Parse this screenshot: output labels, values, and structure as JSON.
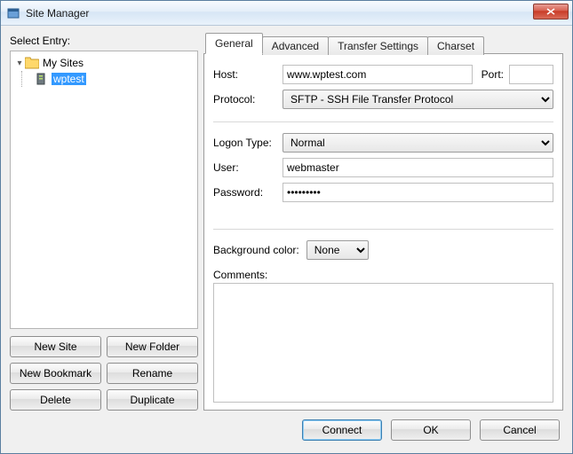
{
  "window": {
    "title": "Site Manager"
  },
  "left": {
    "label": "Select Entry:",
    "root": "My Sites",
    "site": "wptest",
    "buttons": {
      "new_site": "New Site",
      "new_folder": "New Folder",
      "new_bookmark": "New Bookmark",
      "rename": "Rename",
      "delete": "Delete",
      "duplicate": "Duplicate"
    }
  },
  "tabs": {
    "general": "General",
    "advanced": "Advanced",
    "transfer": "Transfer Settings",
    "charset": "Charset"
  },
  "form": {
    "host_label": "Host:",
    "host_value": "www.wptest.com",
    "port_label": "Port:",
    "port_value": "",
    "protocol_label": "Protocol:",
    "protocol_value": "SFTP - SSH File Transfer Protocol",
    "logon_label": "Logon Type:",
    "logon_value": "Normal",
    "user_label": "User:",
    "user_value": "webmaster",
    "password_label": "Password:",
    "password_value": "•••••••••",
    "bg_label": "Background color:",
    "bg_value": "None",
    "comments_label": "Comments:",
    "comments_value": ""
  },
  "footer": {
    "connect": "Connect",
    "ok": "OK",
    "cancel": "Cancel"
  }
}
